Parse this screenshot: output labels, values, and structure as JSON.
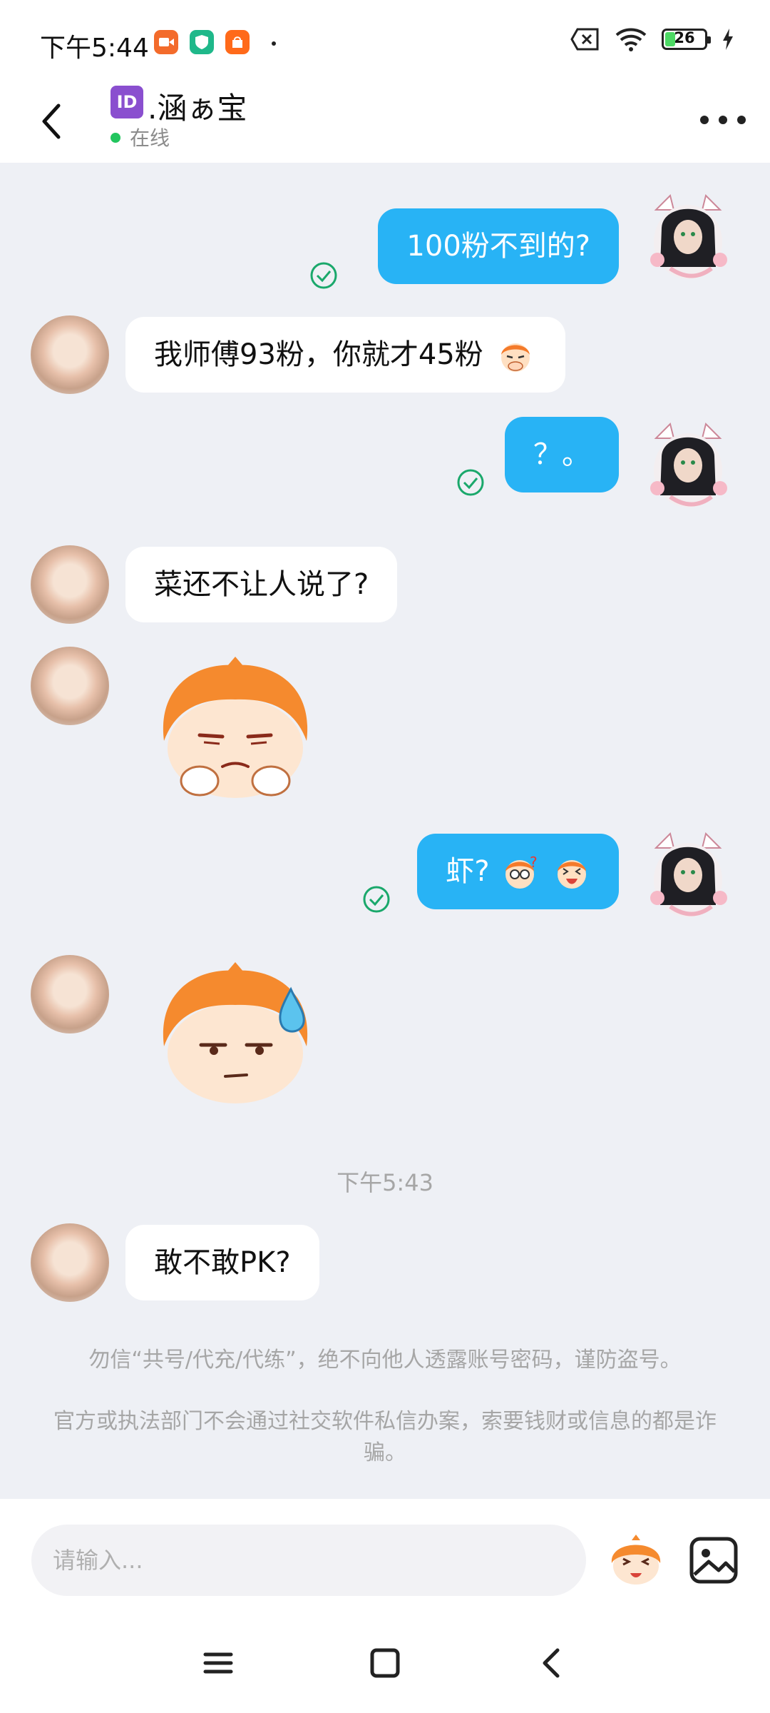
{
  "status_bar": {
    "time": "下午5:44",
    "battery_level": "26",
    "battery_fraction": 0.26,
    "app_icons": [
      "video-app-icon",
      "security-app-icon",
      "shop-app-icon"
    ],
    "status_icons": [
      "sim-missing-icon",
      "wifi-icon",
      "battery-icon",
      "charging-icon"
    ]
  },
  "header": {
    "id_badge": "ID",
    "contact_name": ".涵ぁ宝",
    "presence": "在线",
    "back_icon": "chevron-left-icon",
    "more_icon": "more-icon"
  },
  "messages": [
    {
      "from": "me",
      "text": "100粉不到的?",
      "read": true
    },
    {
      "from": "them",
      "text": "我师傅93粉，你就才45粉",
      "emoji": "covering-mouth-emoji"
    },
    {
      "from": "me",
      "text": "？。",
      "read": true
    },
    {
      "from": "them",
      "text": "菜还不让人说了?"
    },
    {
      "from": "them",
      "sticker": "unamused-sticker"
    },
    {
      "from": "me",
      "text": "虾?",
      "emojis": [
        "confused-emoji",
        "laughing-emoji"
      ],
      "read": true
    },
    {
      "from": "them",
      "sticker": "sweat-sticker"
    },
    {
      "timestamp": "下午5:43"
    },
    {
      "from": "them",
      "text": "敢不敢PK?"
    }
  ],
  "notices": [
    "勿信“共号/代充/代练”，绝不向他人透露账号密码，谨防盗号。",
    "官方或执法部门不会通过社交软件私信办案，索要钱财或信息的都是诈骗。"
  ],
  "input": {
    "placeholder": "请输入...",
    "value": ""
  },
  "colors": {
    "outgoing_bubble": "#28b3f5",
    "incoming_bubble": "#ffffff",
    "chat_background": "#eef0f5",
    "read_check": "#1aa86b",
    "online_dot": "#22c55e"
  },
  "nav": {
    "items": [
      "menu-icon",
      "home-icon",
      "back-icon"
    ]
  }
}
